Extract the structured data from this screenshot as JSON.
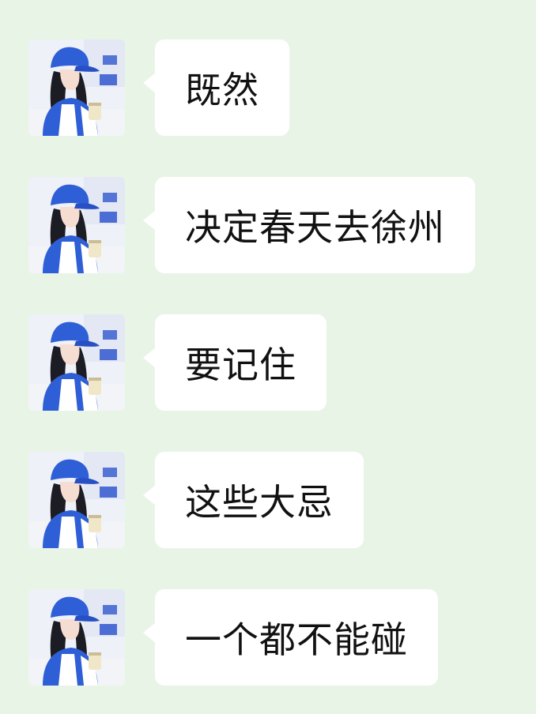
{
  "chat": {
    "messages": [
      {
        "text": "既然"
      },
      {
        "text": "决定春天去徐州"
      },
      {
        "text": "要记住"
      },
      {
        "text": "这些大忌"
      },
      {
        "text": "一个都不能碰"
      }
    ]
  },
  "colors": {
    "background": "#e8f5e6",
    "bubble": "#ffffff",
    "text": "#111111",
    "cap": "#2f5fd6"
  },
  "icons": {
    "avatar": "avatar-girl-blue-cap"
  }
}
